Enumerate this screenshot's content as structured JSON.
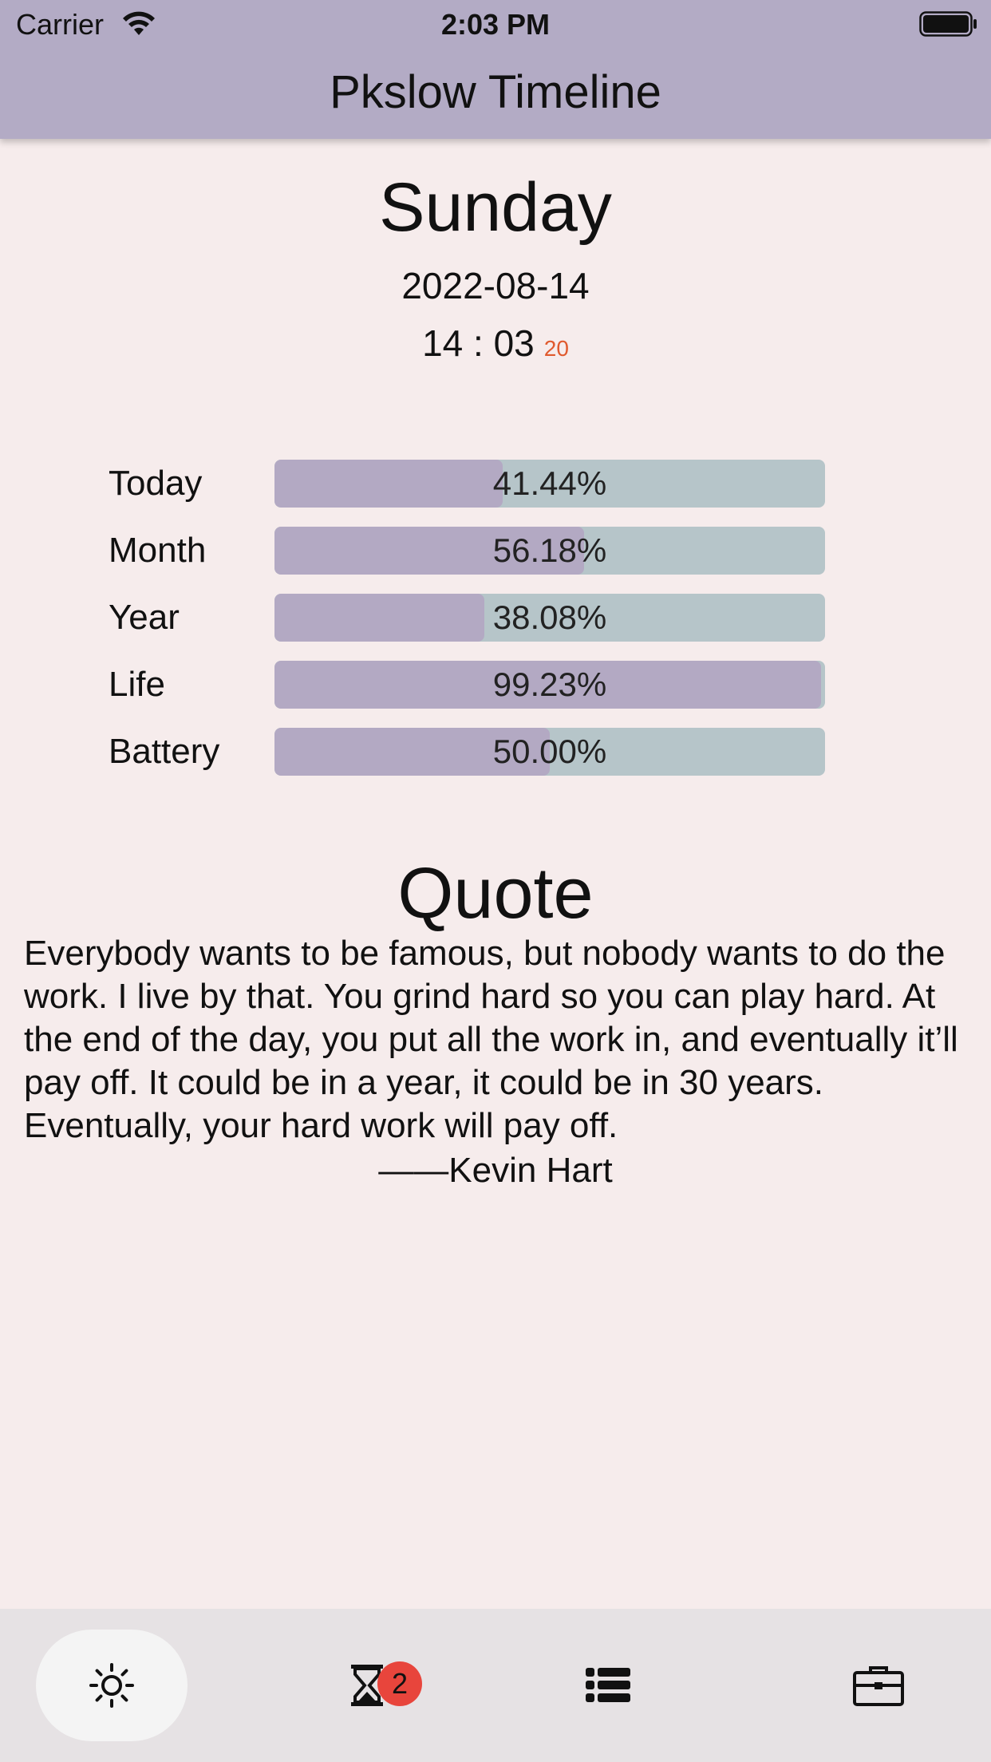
{
  "status_bar": {
    "carrier": "Carrier",
    "time": "2:03 PM"
  },
  "app": {
    "title": "Pkslow Timeline"
  },
  "header": {
    "weekday": "Sunday",
    "date": "2022-08-14",
    "time": "14 : 03",
    "seconds": "20"
  },
  "progress": [
    {
      "label": "Today",
      "text": "41.44%",
      "value": 41.44
    },
    {
      "label": "Month",
      "text": "56.18%",
      "value": 56.18
    },
    {
      "label": "Year",
      "text": "38.08%",
      "value": 38.08
    },
    {
      "label": "Life",
      "text": "99.23%",
      "value": 99.23
    },
    {
      "label": "Battery",
      "text": "50.00%",
      "value": 50.0
    }
  ],
  "quote": {
    "title": "Quote",
    "text": "Everybody wants to be famous, but nobody wants to do the work. I live by that. You grind hard so you can play hard. At the end of the day, you put all the work in, and eventually it’ll pay off. It could be in a year, it could be in 30 years. Eventually, your hard work will pay off.",
    "author": "——Kevin Hart"
  },
  "nav": {
    "items": [
      {
        "icon": "sun-icon",
        "active": true
      },
      {
        "icon": "hourglass-icon",
        "badge": "2"
      },
      {
        "icon": "list-icon"
      },
      {
        "icon": "briefcase-icon"
      }
    ]
  },
  "colors": {
    "app_bar": "#b3abc5",
    "background": "#f6ecec",
    "progress_track": "#b6c5c9",
    "progress_fill": "#b3a9c3",
    "seconds": "#e05a2e",
    "badge": "#e8453c"
  }
}
